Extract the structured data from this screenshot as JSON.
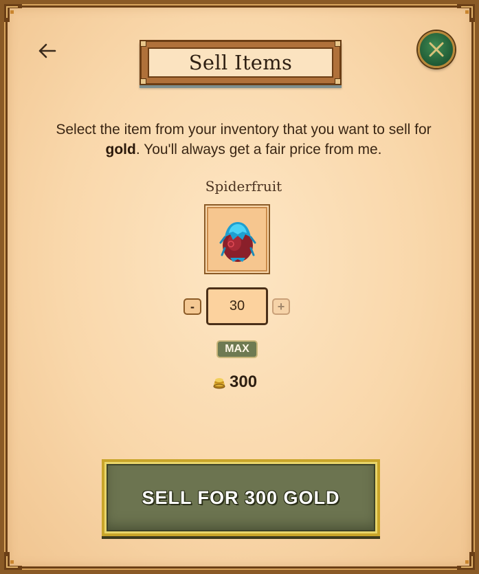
{
  "header": {
    "title": "Sell Items",
    "back_icon": "arrow-left-icon",
    "close_icon": "close-x-icon"
  },
  "description": {
    "before": "Select the item from your inventory that you want to sell for ",
    "bold": "gold",
    "after": ". You'll always get a fair price from me."
  },
  "item": {
    "name": "Spiderfruit",
    "icon": "spiderfruit-icon"
  },
  "quantity": {
    "minus_label": "-",
    "value": "30",
    "plus_label": "+",
    "max_label": "MAX"
  },
  "total": {
    "icon": "gold-coins-icon",
    "amount": "300"
  },
  "sell_button": {
    "label": "SELL FOR 300 GOLD"
  },
  "colors": {
    "panel": "#f9d7aa",
    "frame": "#8a5a26",
    "close_button": "#1f5a35",
    "sell_button": "#6c7450",
    "max_button": "#6e7a52"
  }
}
